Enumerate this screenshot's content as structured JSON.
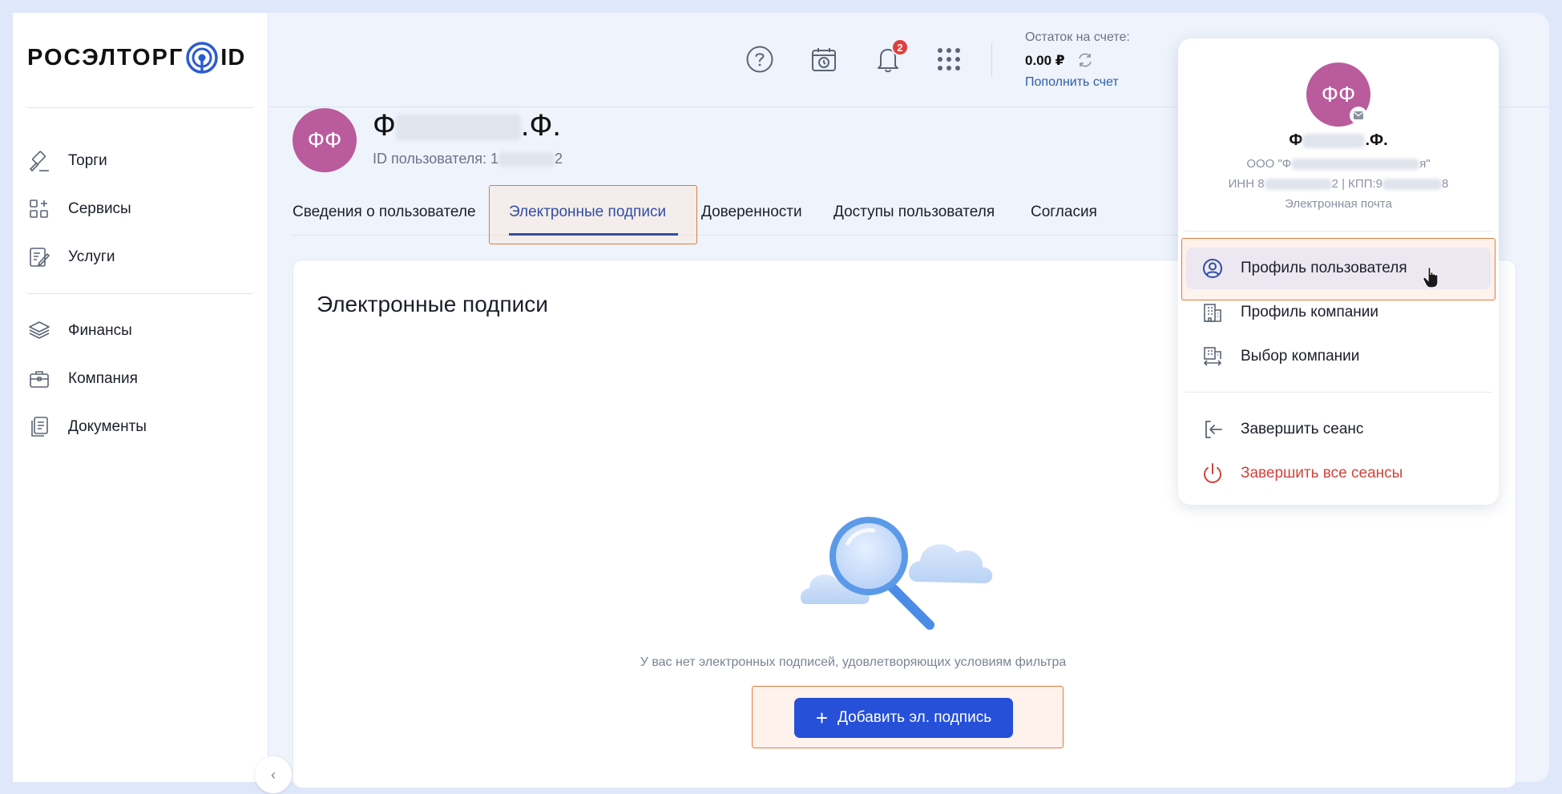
{
  "logo": {
    "text": "РОСЭЛТОРГ",
    "suffix": "ID"
  },
  "sidebar": {
    "items": [
      {
        "label": "Торги",
        "icon": "gavel-icon"
      },
      {
        "label": "Сервисы",
        "icon": "grid-plus-icon"
      },
      {
        "label": "Услуги",
        "icon": "edit-document-icon"
      },
      {
        "label": "Финансы",
        "icon": "stack-icon"
      },
      {
        "label": "Компания",
        "icon": "briefcase-icon"
      },
      {
        "label": "Документы",
        "icon": "documents-icon"
      }
    ]
  },
  "header": {
    "notifications_count": "2",
    "balance_label": "Остаток на счете:",
    "balance_value": "0.00 ₽",
    "topup_label": "Пополнить счет"
  },
  "user": {
    "initials": "ФФ",
    "name_start": "Ф",
    "name_end": ".Ф.",
    "id_label": "ID пользователя: 1",
    "id_end": "2"
  },
  "tabs": [
    {
      "label": "Сведения о пользователе"
    },
    {
      "label": "Электронные подписи"
    },
    {
      "label": "Доверенности"
    },
    {
      "label": "Доступы пользователя"
    },
    {
      "label": "Согласия"
    }
  ],
  "card": {
    "title": "Электронные подписи",
    "empty_message": "У вас нет электронных подписей, удовлетворяющих условиям фильтра",
    "add_button": "Добавить эл. подпись"
  },
  "dropdown": {
    "initials": "ФФ",
    "name_start": "Ф",
    "name_end": ".Ф.",
    "org_start": "ООО \"Ф",
    "org_end": "я\"",
    "inn_start": "ИНН 8",
    "inn_mid": "2 | КПП:9",
    "inn_end": "8",
    "email_label": "Электронная почта",
    "items": [
      {
        "label": "Профиль пользователя"
      },
      {
        "label": "Профиль компании"
      },
      {
        "label": "Выбор компании"
      },
      {
        "label": "Завершить сеанс"
      },
      {
        "label": "Завершить все сеансы"
      }
    ]
  },
  "colors": {
    "accent": "#2650d8",
    "avatar": "#b95b9c",
    "danger": "#d0433d",
    "highlight_border": "#e07a3e"
  }
}
